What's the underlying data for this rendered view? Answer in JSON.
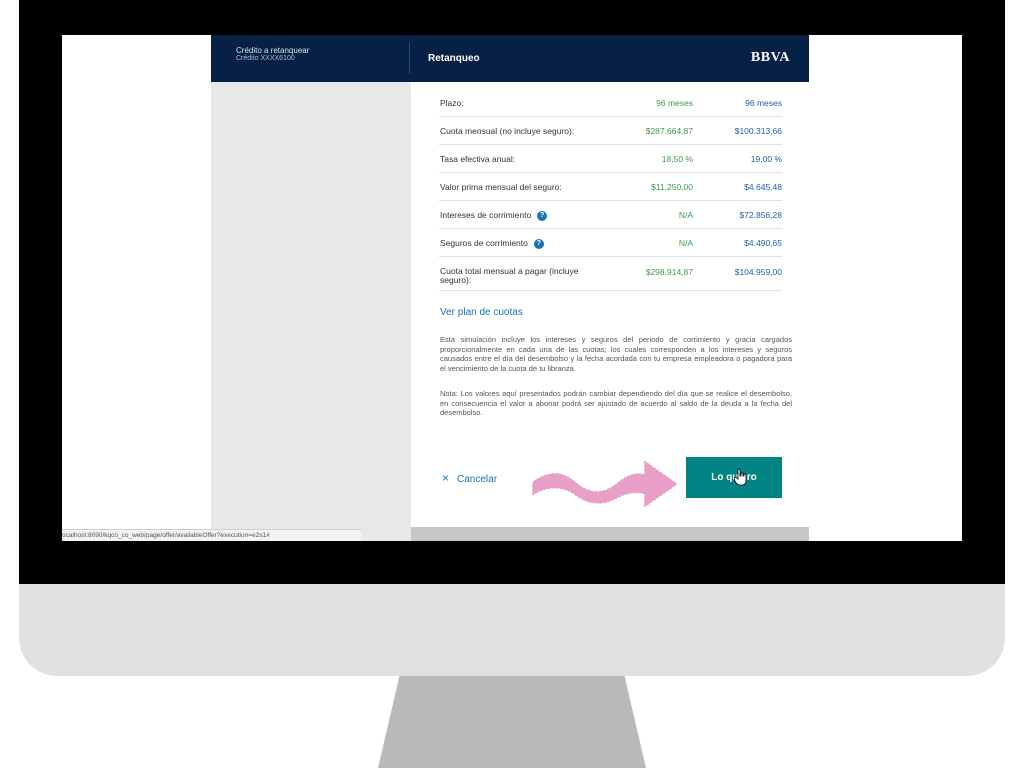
{
  "header": {
    "title": "Crédito a retanquear",
    "subtitle": "Crédito XXXX6100",
    "section": "Retanqueo",
    "logo": "BBVA"
  },
  "table": {
    "rows": [
      {
        "label": "Plazo:",
        "col1": "96 meses",
        "col2": "96 meses",
        "help": false
      },
      {
        "label": "Cuota mensual (no incluye seguro):",
        "col1": "$287.664,87",
        "col2": "$100.313,66",
        "help": false
      },
      {
        "label": "Tasa efectiva anual:",
        "col1": "18,50 %",
        "col2": "19,00 %",
        "help": false
      },
      {
        "label": "Valor prima mensual del seguro:",
        "col1": "$11.250,00",
        "col2": "$4.645,48",
        "help": false
      },
      {
        "label": "Intereses de corrimiento",
        "col1": "N/A",
        "col2": "$72.856,28",
        "help": true
      },
      {
        "label": "Seguros de corrimiento",
        "col1": "N/A",
        "col2": "$4.490,65",
        "help": true
      },
      {
        "label": "Cuota total mensual a pagar (incluye seguro):",
        "col1": "$298.914,87",
        "col2": "$104.959,00",
        "help": false
      }
    ],
    "help_glyph": "?"
  },
  "plan_link": "Ver plan de cuotas",
  "paragraphs": {
    "p1": "Esta simulación incluye los intereses y seguros del periodo de corrimiento y gracia cargados proporcionalmente en cada una de las cuotas; los cuales corresponden a los intereses y seguros causados entre el día del desembolso y la fecha acordada con tu empresa empleadora o pagadora para el vencimiento de la cuota de tu libranza.",
    "p2": "Nota: Los valores aquí presentados podrán cambiar dependiendo del día que se realice el desembolso, en consecuencia el valor a abonar podrá ser ajustado de acuerdo al saldo de la deuda a la fecha del desembolso."
  },
  "actions": {
    "cancel_label": "Cancelar",
    "cancel_icon": "×",
    "primary_label": "Lo quiero"
  },
  "status_bar": {
    "url": "ocalhost:8090/kqco_co_web/page/offer/availableOffer?execution=e2s1#"
  },
  "colors": {
    "header_bg": "#072146",
    "accent_blue": "#1973b8",
    "button_teal": "#028484",
    "value_green": "#3f9b4d",
    "arrow_pink": "#e8a0c8"
  }
}
